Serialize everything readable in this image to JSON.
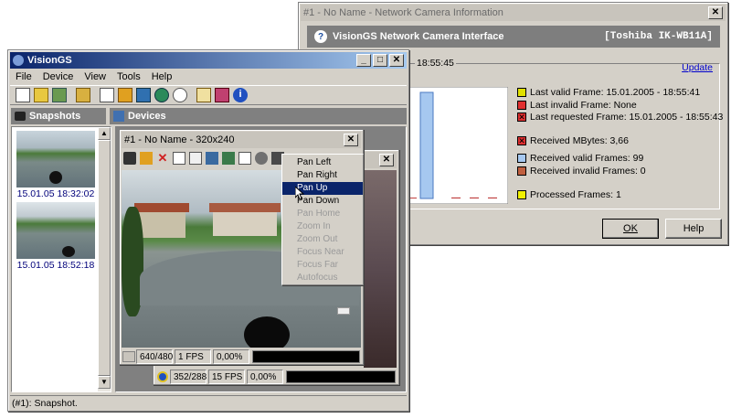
{
  "info_window": {
    "title": "#1 - No Name - Network Camera Information",
    "header_title": "VisionGS Network Camera Interface",
    "header_model": "[Toshiba IK-WB11A]",
    "partial_time": "18:55:45",
    "update_link": "Update",
    "stats": [
      {
        "label": "Last valid Frame: 15.01.2005 - 18:55:41",
        "color": "#e0e000"
      },
      {
        "label": "Last invalid Frame: None",
        "color": "#e03030"
      },
      {
        "label": "Last requested Frame: 15.01.2005 - 18:55:43",
        "color": "#e03030"
      },
      {
        "label": "Received MBytes: 3,66",
        "color": "#e03030"
      },
      {
        "label": "Received valid Frames: 99",
        "color": "#a6c8f0"
      },
      {
        "label": "Received invalid Frames: 0",
        "color": "#c06040"
      },
      {
        "label": "Processed Frames: 1",
        "color": "#f0f000"
      }
    ],
    "ok_label": "OK",
    "help_label": "Help"
  },
  "main_window": {
    "title": "VisionGS",
    "menu": [
      "File",
      "Device",
      "View",
      "Tools",
      "Help"
    ],
    "snapshots_header": "Snapshots",
    "devices_header": "Devices",
    "snapshots": [
      {
        "caption": "15.01.05 18:32:02"
      },
      {
        "caption": "15.01.05 18:52:18"
      }
    ],
    "status_text": "(#1): Snapshot."
  },
  "camera_window": {
    "title": "#1 - No Name - 320x240",
    "resolution": "640/480",
    "fps": "1 FPS",
    "percent": "0,00%"
  },
  "second_camera": {
    "resolution": "352/288",
    "fps": "15 FPS",
    "percent": "0,00%"
  },
  "context_menu": {
    "items": [
      {
        "label": "Pan Left",
        "state": "enabled"
      },
      {
        "label": "Pan Right",
        "state": "enabled"
      },
      {
        "label": "Pan Up",
        "state": "selected"
      },
      {
        "label": "Pan Down",
        "state": "enabled"
      },
      {
        "label": "Pan Home",
        "state": "disabled"
      },
      {
        "label": "Zoom In",
        "state": "disabled"
      },
      {
        "label": "Zoom Out",
        "state": "disabled"
      },
      {
        "label": "Focus Near",
        "state": "disabled"
      },
      {
        "label": "Focus Far",
        "state": "disabled"
      },
      {
        "label": "Autofocus",
        "state": "disabled"
      }
    ]
  },
  "chart_data": {
    "type": "bar",
    "categories": [
      "",
      "",
      "",
      "",
      ""
    ],
    "series": [
      {
        "values": [
          0.0,
          1.0,
          0.01,
          0.01,
          0.01
        ],
        "color": "#a6c8f0"
      }
    ]
  }
}
